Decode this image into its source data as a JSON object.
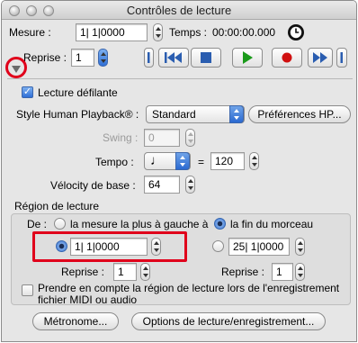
{
  "window": {
    "title": "Contrôles de lecture"
  },
  "top": {
    "mesure_label": "Mesure :",
    "mesure_value": "1| 1|0000",
    "temps_label": "Temps :",
    "temps_value": "00:00:00.000",
    "reprise_label": "Reprise :",
    "reprise_value": "1"
  },
  "transport": {
    "rewind_icon": "rewind-icon",
    "stop_icon": "stop-icon",
    "play_icon": "play-icon",
    "record_icon": "record-icon",
    "fastforward_icon": "fast-forward-icon",
    "play_color": "#1a9a1a",
    "record_color": "#d01010",
    "arrow_color": "#2a5db0"
  },
  "options": {
    "lecture_defilante_label": "Lecture défilante",
    "lecture_defilante_checked": true,
    "style_label": "Style Human Playback® :",
    "style_value": "Standard",
    "hp_button": "Préférences HP...",
    "swing_label": "Swing :",
    "swing_value": "0",
    "tempo_label": "Tempo :",
    "tempo_equals": "=",
    "tempo_value": "120",
    "tempo_note": "♩",
    "velocite_label": "Vélocity de base :",
    "velocite_value": "64"
  },
  "region": {
    "heading": "Région de lecture",
    "de_label": "De :",
    "left_option": "la mesure la plus à gauche à",
    "left_selected": false,
    "end_option": "la fin du morceau",
    "end_selected": true,
    "start_value": "1| 1|0000",
    "start_selected": true,
    "end_value": "25| 1|0000",
    "end_value_selected": false,
    "reprise_label": "Reprise :",
    "reprise_left_value": "1",
    "reprise_right_value": "1",
    "record_checkbox_label": "Prendre en compte la région de lecture lors de l'enregistrement fichier MIDI ou audio",
    "record_checkbox_checked": false
  },
  "footer": {
    "metronome_button": "Métronome...",
    "options_button": "Options de lecture/enregistrement..."
  },
  "colors": {
    "highlight": "#e0001b",
    "accent_blue": "#2a69d1"
  }
}
